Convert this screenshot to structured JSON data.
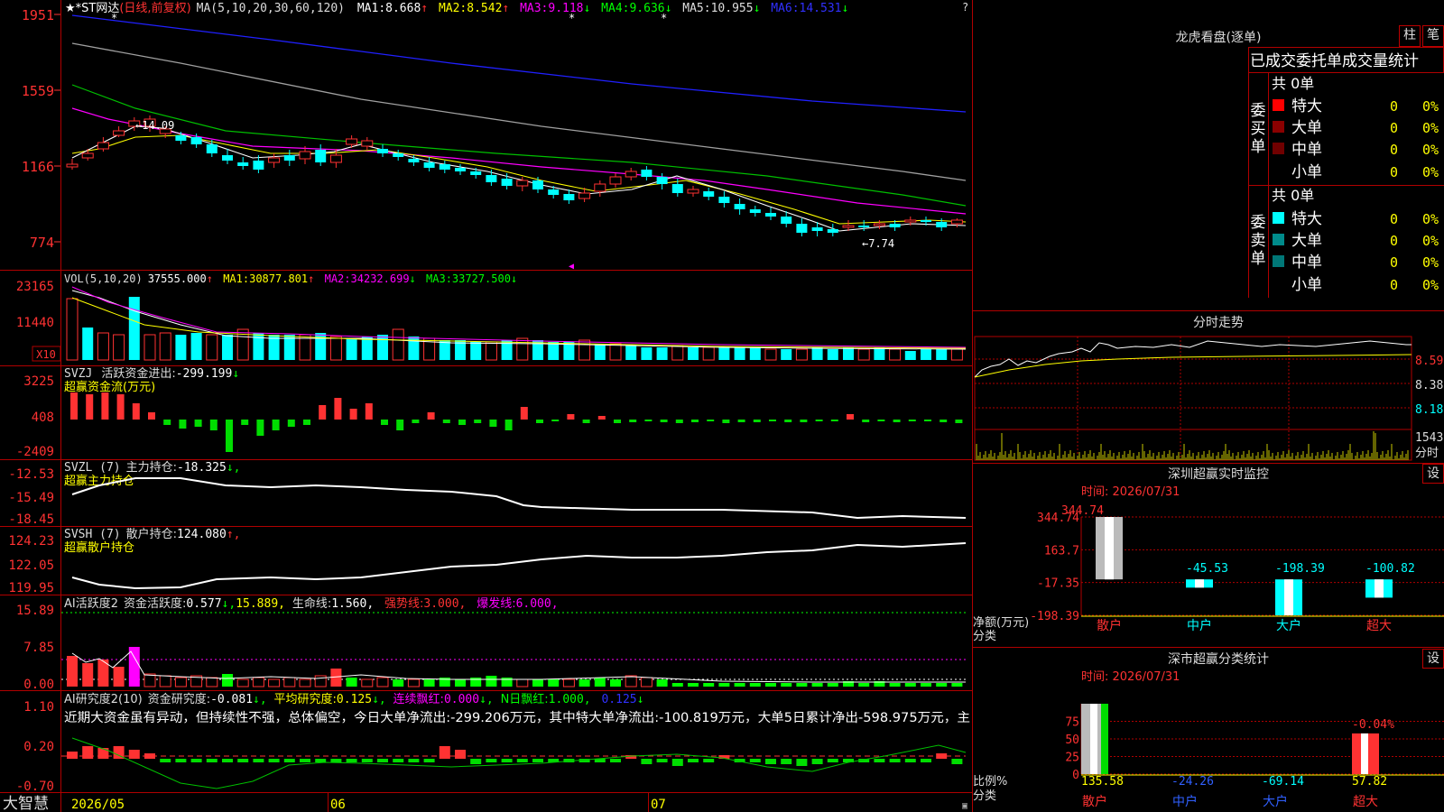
{
  "colors": {
    "up": "#ff3232",
    "down": "#00ffff",
    "ma1": "#ffffff",
    "ma2": "#ffff00",
    "ma3": "#ff00ff",
    "ma4": "#00ff00",
    "ma5": "#a0a0a0",
    "ma6": "#2020ff",
    "grid": "#b00000",
    "axis": "#ff3232"
  },
  "main": {
    "title": "★*ST网达",
    "period": "(日线,前复权)",
    "ma_label": "MA(5,10,20,30,60,120)",
    "ma": [
      {
        "name": "MA1:",
        "value": "8.668",
        "arrow": "↑"
      },
      {
        "name": "MA2:",
        "value": "8.542",
        "arrow": "↑"
      },
      {
        "name": "MA3:",
        "value": "9.118",
        "arrow": "↓"
      },
      {
        "name": "MA4:",
        "value": "9.636",
        "arrow": "↓"
      },
      {
        "name": "MA5:",
        "value": "10.955",
        "arrow": "↓"
      },
      {
        "name": "MA6:",
        "value": "14.531",
        "arrow": "↓"
      }
    ],
    "yticks": [
      "1951",
      "1559",
      "1166",
      "774"
    ],
    "hi_label": "14.09",
    "lo_label": "7.74"
  },
  "vol": {
    "label": "VOL(5,10,20)",
    "value": "37555.000",
    "v_arrow": "↑",
    "ma": [
      {
        "name": "MA1:",
        "value": "30877.801",
        "arrow": "↑"
      },
      {
        "name": "MA2:",
        "value": "34232.699",
        "arrow": "↓"
      },
      {
        "name": "MA3:",
        "value": "33727.500",
        "arrow": "↓"
      }
    ],
    "yticks": [
      "23165",
      "11440"
    ],
    "unit": "X10"
  },
  "svzj": {
    "label": "SVZJ",
    "name": "活跃资金进出:",
    "value": "-299.199",
    "arrow": "↓",
    "sub": "超赢资金流(万元)",
    "yticks": [
      "3225",
      "408",
      "-2409"
    ]
  },
  "svzl": {
    "label": "SVZL (7)",
    "name": "主力持仓:",
    "value": "-18.325",
    "arrow": "↓,",
    "sub": "超赢主力持仓",
    "yticks": [
      "-12.53",
      "-15.49",
      "-18.45"
    ]
  },
  "svsh": {
    "label": "SVSH (7)",
    "name": "散户持仓:",
    "value": "124.080",
    "arrow": "↑,",
    "sub": "超赢散户持仓",
    "yticks": [
      "124.23",
      "122.05",
      "119.95"
    ]
  },
  "ai1": {
    "label": "AI活跃度2",
    "t1": "资金活跃度:",
    "v1": "0.577",
    "a1": "↓,",
    "v2": "15.889,",
    "t3": "生命线:",
    "v3": "1.560,",
    "t4": "强势线:",
    "v4": "3.000,",
    "t5": "爆发线:",
    "v5": "6.000,",
    "yticks": [
      "15.89",
      "7.85",
      "0.00"
    ]
  },
  "ai2": {
    "label": "AI研究度2(10)",
    "t1": "资金研究度:",
    "v1": "-0.081",
    "a1": "↓,",
    "t2": "平均研究度:",
    "v2": "0.125",
    "a2": "↓,",
    "t3": "连续飘红:",
    "v3": "0.000",
    "a3": "↓,",
    "t4": "N日飘红:",
    "v4": "1.000,",
    "v5": "0.125",
    "a5": "↓",
    "comment": "近期大资金虽有异动，但持续性不强，总体偏空，今日大单净流出:-299.206万元，其中特大单净流出:-100.819万元，大单5日累计净出-598.975万元，主",
    "yticks": [
      "1.10",
      "0.20",
      "-0.70"
    ]
  },
  "xaxis": {
    "labels": [
      "2026/05",
      "06",
      "07"
    ]
  },
  "brand": "大智慧",
  "right": {
    "longhu_title": "龙虎看盘(逐单)",
    "btn_zhu": "柱",
    "btn_bi": "笔",
    "stats_title": "已成交委托单成交量统计",
    "buy_side": "委买单",
    "sell_side": "委卖单",
    "buy_total": "共 0单",
    "sell_total": "共 0单",
    "buy_rows": [
      {
        "name": "特大",
        "num": "0",
        "pct": "0%",
        "color": "#ff0000"
      },
      {
        "name": "大单",
        "num": "0",
        "pct": "0%",
        "color": "#8b0000"
      },
      {
        "name": "中单",
        "num": "0",
        "pct": "0%",
        "color": "#700000"
      },
      {
        "name": "小单",
        "num": "0",
        "pct": "0%",
        "color": "#000000"
      }
    ],
    "sell_rows": [
      {
        "name": "特大",
        "num": "0",
        "pct": "0%",
        "color": "#00ffff"
      },
      {
        "name": "大单",
        "num": "0",
        "pct": "0%",
        "color": "#008b8b"
      },
      {
        "name": "中单",
        "num": "0",
        "pct": "0%",
        "color": "#007777"
      },
      {
        "name": "小单",
        "num": "0",
        "pct": "0%",
        "color": "#000000"
      }
    ],
    "fenshi_title": "分时走势",
    "fenshi_yticks": [
      "8.59",
      "8.38",
      "8.18"
    ],
    "fenshi_vol": "1543",
    "fenshi_unit": "分时",
    "monitor_title": "深圳超赢实时监控",
    "monitor_set": "设",
    "monitor_time": "时间: 2026/07/31",
    "monitor_yticks": [
      "344.74",
      "163.7",
      "-17.35",
      "-198.39"
    ],
    "monitor_ylabel": "净额(万元)",
    "monitor_xlabel": "分类",
    "monitor_bars": [
      {
        "cat": "散户",
        "value": 344.74,
        "label": "344.74"
      },
      {
        "cat": "中户",
        "value": -45.53,
        "label": "-45.53"
      },
      {
        "cat": "大户",
        "value": -198.39,
        "label": "-198.39"
      },
      {
        "cat": "超大",
        "value": -100.82,
        "label": "-100.82"
      }
    ],
    "class_title": "深市超赢分类统计",
    "class_set": "设",
    "class_time": "时间: 2026/07/31",
    "class_yticks": [
      "75",
      "50",
      "25",
      "0"
    ],
    "class_ylabel": "比例%",
    "class_xlabel": "分类",
    "class_bars": [
      {
        "cat": "散户",
        "value": 135.58,
        "label": "135.58"
      },
      {
        "cat": "中户",
        "value": -24.26,
        "label": "-24.26"
      },
      {
        "cat": "大户",
        "value": -69.14,
        "label": "-69.14"
      },
      {
        "cat": "超大",
        "value": 57.82,
        "label": "57.82"
      }
    ],
    "class_top_label": "-0.04%"
  }
}
